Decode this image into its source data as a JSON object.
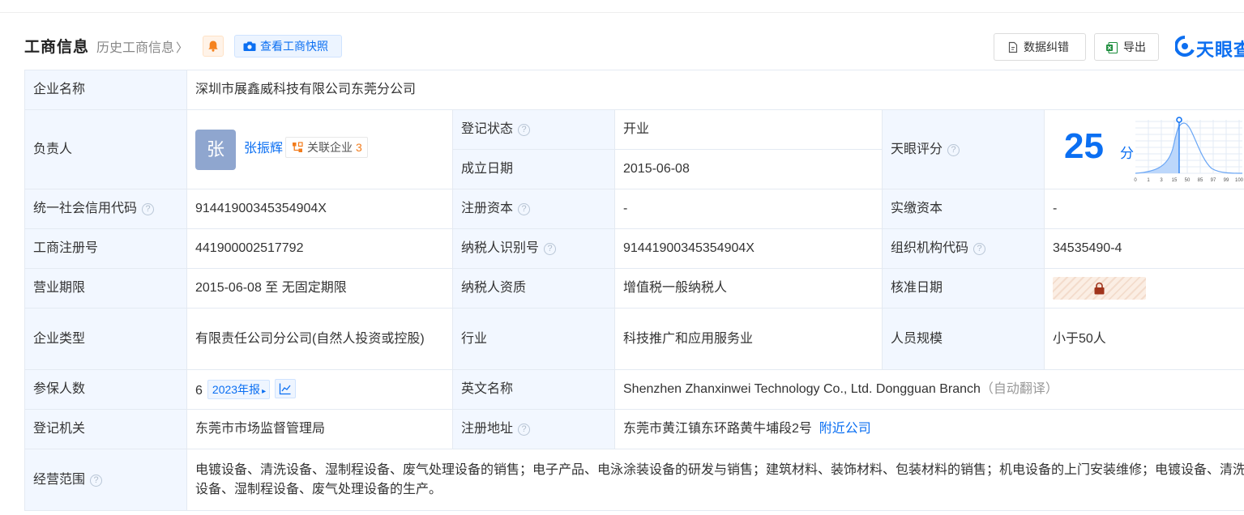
{
  "header": {
    "title": "工商信息",
    "history_link": "历史工商信息",
    "snapshot_button": "查看工商快照",
    "feedback_button": "数据纠错",
    "export_button": "导出",
    "logo_text": "天眼查"
  },
  "company": {
    "name_label": "企业名称",
    "name": "深圳市展鑫威科技有限公司东莞分公司",
    "person_label": "负责人",
    "person_avatar": "张",
    "person_name": "张振辉",
    "related_label": "关联企业",
    "related_count": "3",
    "status_label": "登记状态",
    "status": "开业",
    "found_date_label": "成立日期",
    "found_date": "2015-06-08",
    "score_label": "天眼评分",
    "score": "25",
    "score_unit": "分",
    "score_axis_ticks": [
      "0",
      "1",
      "3",
      "15",
      "50",
      "85",
      "97",
      "99",
      "100"
    ],
    "credit_code_label": "统一社会信用代码",
    "credit_code": "91441900345354904X",
    "reg_capital_label": "注册资本",
    "reg_capital": "-",
    "paid_capital_label": "实缴资本",
    "paid_capital": "-",
    "reg_no_label": "工商注册号",
    "reg_no": "441900002517792",
    "tax_id_label": "纳税人识别号",
    "tax_id": "91441900345354904X",
    "org_code_label": "组织机构代码",
    "org_code": "34535490-4",
    "term_label": "营业期限",
    "term": "2015-06-08 至 无固定期限",
    "tax_qual_label": "纳税人资质",
    "tax_qual": "增值税一般纳税人",
    "approve_date_label": "核准日期",
    "type_label": "企业类型",
    "type": "有限责任公司分公司(自然人投资或控股)",
    "industry_label": "行业",
    "industry": "科技推广和应用服务业",
    "staff_label": "人员规模",
    "staff": "小于50人",
    "insured_label": "参保人数",
    "insured": "6",
    "insured_report": "2023年报",
    "english_label": "英文名称",
    "english_name": "Shenzhen Zhanxinwei Technology Co., Ltd. Dongguan Branch",
    "english_note": "（自动翻译）",
    "authority_label": "登记机关",
    "authority": "东莞市市场监督管理局",
    "address_label": "注册地址",
    "address": "东莞市黄江镇东环路黄牛埔段2号",
    "nearby_link": "附近公司",
    "scope_label": "经营范围",
    "scope": "电镀设备、清洗设备、湿制程设备、废气处理设备的销售；电子产品、电泳涂装设备的研发与销售；建筑材料、装饰材料、包装材料的销售；机电设备的上门安装维修；电镀设备、清洗设备、湿制程设备、废气处理设备的生产。"
  },
  "colors": {
    "accent": "#0b6ff2",
    "status_green": "#1e9a3c",
    "label_bg": "#f2f7ff",
    "related_count": "#f27c1c"
  },
  "icons": [
    "chevron-right-icon",
    "bell-icon",
    "camera-icon",
    "edit-doc-icon",
    "excel-icon",
    "tianyancha-logo-icon",
    "question-icon",
    "related-network-icon",
    "lock-icon",
    "trend-chart-icon"
  ]
}
